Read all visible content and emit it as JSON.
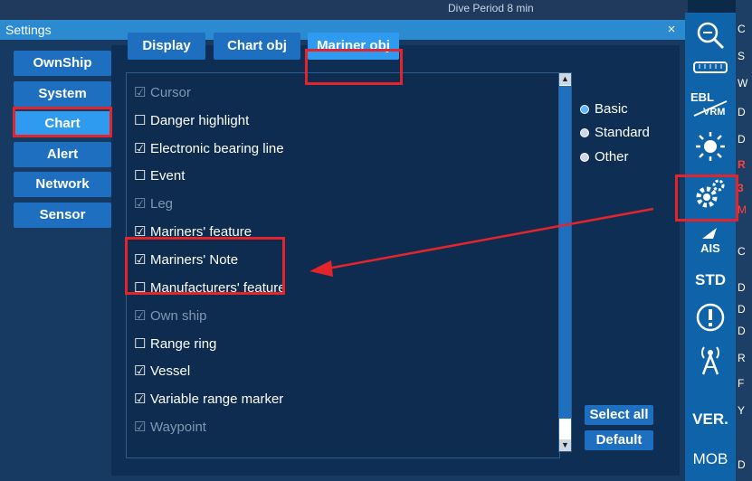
{
  "background": {
    "peek_text": "Dive Period 8 min"
  },
  "dialog": {
    "title": "Settings",
    "close": "×"
  },
  "categories": [
    {
      "label": "OwnShip"
    },
    {
      "label": "System"
    },
    {
      "label": "Chart",
      "active": true
    },
    {
      "label": "Alert"
    },
    {
      "label": "Network"
    },
    {
      "label": "Sensor"
    }
  ],
  "tabs": [
    {
      "label": "Display"
    },
    {
      "label": "Chart obj"
    },
    {
      "label": "Mariner obj",
      "active": true
    }
  ],
  "items": [
    {
      "label": "Cursor",
      "checked": true,
      "disabled": true
    },
    {
      "label": "Danger highlight",
      "checked": false,
      "disabled": false
    },
    {
      "label": "Electronic bearing line",
      "checked": true,
      "disabled": false
    },
    {
      "label": "Event",
      "checked": false,
      "disabled": false
    },
    {
      "label": "Leg",
      "checked": true,
      "disabled": true
    },
    {
      "label": "Mariners' feature",
      "checked": true,
      "disabled": false
    },
    {
      "label": "Mariners' Note",
      "checked": true,
      "disabled": false
    },
    {
      "label": "Manufacturers' feature",
      "checked": false,
      "disabled": false
    },
    {
      "label": "Own ship",
      "checked": true,
      "disabled": true
    },
    {
      "label": "Range ring",
      "checked": false,
      "disabled": false
    },
    {
      "label": "Vessel",
      "checked": true,
      "disabled": false
    },
    {
      "label": "Variable range marker",
      "checked": true,
      "disabled": false
    },
    {
      "label": "Waypoint",
      "checked": true,
      "disabled": true
    }
  ],
  "checkbox_glyphs": {
    "checked": "☑",
    "unchecked": "☐"
  },
  "radio_options": [
    {
      "label": "Basic",
      "selected": true
    },
    {
      "label": "Standard",
      "selected": false
    },
    {
      "label": "Other",
      "selected": false
    }
  ],
  "buttons": {
    "select_all": "Select all",
    "default": "Default"
  },
  "scrollbar": {
    "up": "▲",
    "down": "▼"
  },
  "toolbar": {
    "ebl": "EBL",
    "vrm": "VRM",
    "ais": "AIS",
    "std": "STD",
    "ver": "VER.",
    "mob": "MOB"
  },
  "right_strip": [
    "C",
    "S",
    "W",
    "D",
    "D",
    "R",
    "3",
    "M",
    "C",
    "D",
    "D",
    "D",
    "R",
    "F",
    "Y",
    "D"
  ],
  "colors": {
    "accent": "#2f9bf0",
    "button": "#1f6fc0",
    "panel": "#0f2e53",
    "annotation": "#e3252b",
    "toolbar": "#0f63a8"
  }
}
